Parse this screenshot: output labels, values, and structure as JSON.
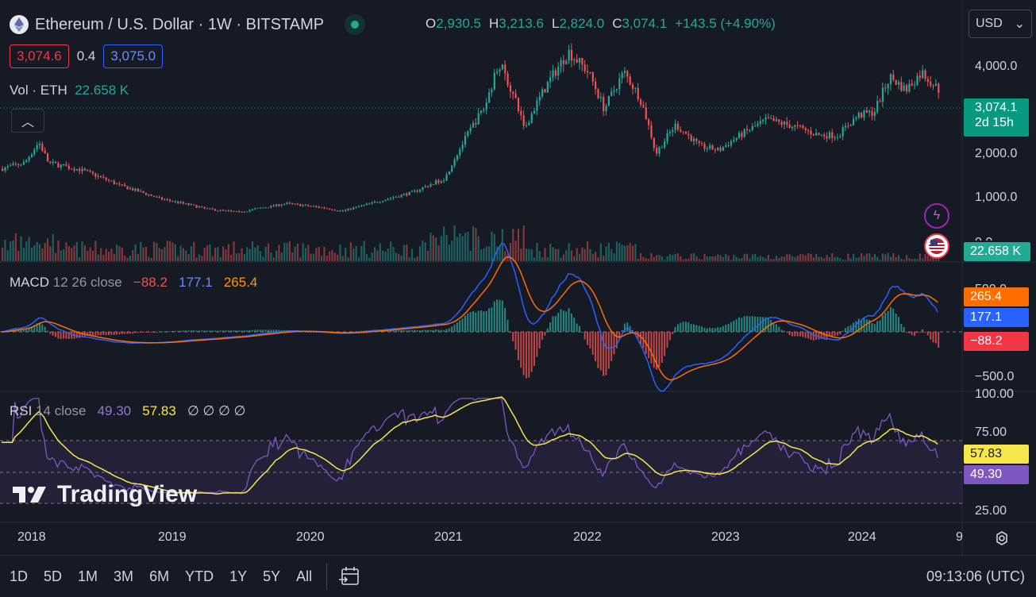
{
  "header": {
    "symbol_title": "Ethereum / U.S. Dollar · 1W · BITSTAMP",
    "open_k": "O",
    "open_v": "2,930.5",
    "high_k": "H",
    "high_v": "3,213.6",
    "low_k": "L",
    "low_v": "2,824.0",
    "close_k": "C",
    "close_v": "3,074.1",
    "change": "+143.5 (+4.90%)",
    "bid": "3,074.6",
    "spread": "0.4",
    "ask": "3,075.0",
    "currency": "USD",
    "currency_chevron": "⌄"
  },
  "volume": {
    "label": "Vol · ETH",
    "value": "22.658 K"
  },
  "price_axis": {
    "ticks": [
      "4,000.0",
      "2,000.0",
      "1,000.0",
      "0.0"
    ],
    "last_price": "3,074.1",
    "countdown": "2d 15h",
    "volume_tag": "22.658 K"
  },
  "macd": {
    "label": "MACD",
    "params": "12 26 close",
    "hist": "−88.2",
    "macd": "177.1",
    "signal": "265.4",
    "axis": [
      "500.0",
      "0.0",
      "−500.0"
    ]
  },
  "rsi": {
    "label": "RSI",
    "params": "14 close",
    "rsi": "49.30",
    "ma": "57.83",
    "empty": "∅ ∅ ∅ ∅",
    "axis": [
      "100.00",
      "75.00",
      "25.00"
    ]
  },
  "time_axis": [
    "2018",
    "2019",
    "2020",
    "2021",
    "2022",
    "2023",
    "2024"
  ],
  "time_axis_partial": "9",
  "timeframes": [
    "1D",
    "5D",
    "1M",
    "3M",
    "6M",
    "YTD",
    "1Y",
    "5Y",
    "All"
  ],
  "clock": "09:13:06 (UTC)",
  "logo": "TradingView",
  "colors": {
    "up": "#26a69a",
    "down": "#ef5350",
    "macd": "#2962ff",
    "signal": "#ff6d00",
    "rsi": "#7e57c2",
    "rsi_ma": "#f7e64b",
    "bg": "#161a25"
  }
}
